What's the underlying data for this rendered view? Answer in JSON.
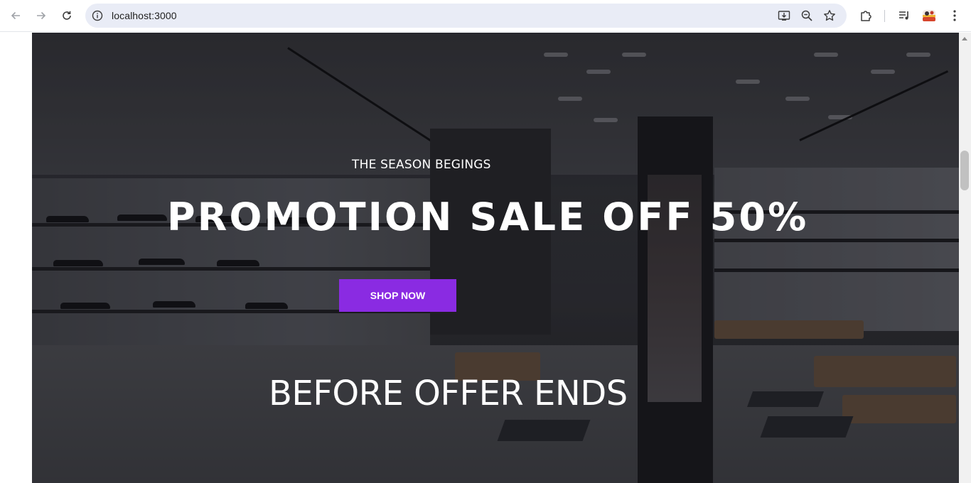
{
  "browser": {
    "url": "localhost:3000",
    "icons": {
      "back": "arrow-left-icon",
      "forward": "arrow-right-icon",
      "reload": "reload-icon",
      "site_info": "info-icon",
      "install": "install-app-icon",
      "zoom": "zoom-icon",
      "bookmark": "star-icon",
      "extensions": "puzzle-icon",
      "media": "media-controls-icon",
      "profile": "profile-avatar-icon",
      "menu": "kebab-menu-icon"
    }
  },
  "hero": {
    "subtitle": "THE SEASON BEGINGS",
    "title": "PROMOTION SALE OFF 50%",
    "cta_label": "SHOP NOW",
    "offer_text": "BEFORE OFFER ENDS"
  },
  "colors": {
    "accent": "#8a2be2",
    "hero_text": "#ffffff"
  }
}
